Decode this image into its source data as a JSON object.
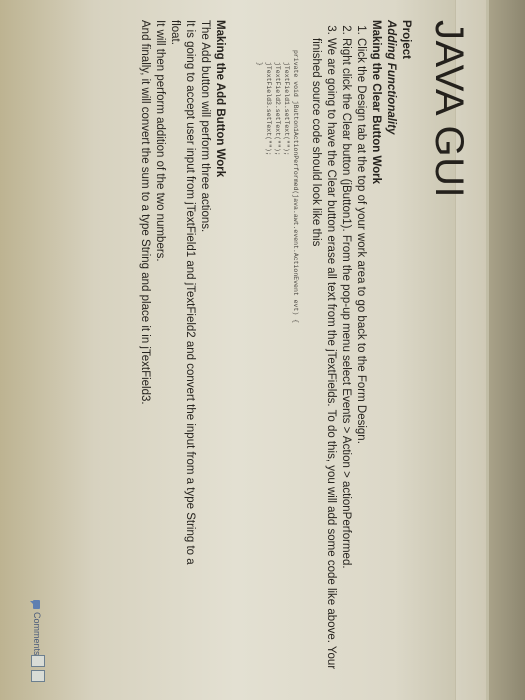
{
  "document": {
    "title": "JAVA GUI",
    "project_label": "Project",
    "subtitle": "Adding Functionality",
    "section1": {
      "heading": "Making the Clear Button Work",
      "steps": [
        "Click the Design tab at the top of your work area to go back to the Form Design.",
        "Right click the Clear button (jButton1). From the pop-up menu select Events > Action > actionPerformed.",
        "We are going to have the Clear button erase all text from the jTextFields. To do this, you will add some code like above. Your finished source code should look like this"
      ],
      "code": [
        "private void jButton1ActionPerformed(java.awt.event.ActionEvent evt) {",
        "jTextField1.setText(\"\");",
        "jTextField2.setText(\"\");",
        "jTextField3.setText(\"\");",
        "}"
      ]
    },
    "section2": {
      "heading": "Making the Add Button Work",
      "lines": [
        "The Add button will perform three actions.",
        "It is going to accept user input from jTextField1 and jTextField2 and convert the input from a type String to a",
        "float.",
        "It will then perform addition of the two numbers.",
        "And finally, it will convert the sum to a type String and place it in jTextField3."
      ]
    },
    "statusbar": {
      "comments_label": "Comments",
      "comments_icon": "comment-icon",
      "view_icons": [
        "print-layout-icon",
        "web-layout-icon"
      ]
    }
  }
}
